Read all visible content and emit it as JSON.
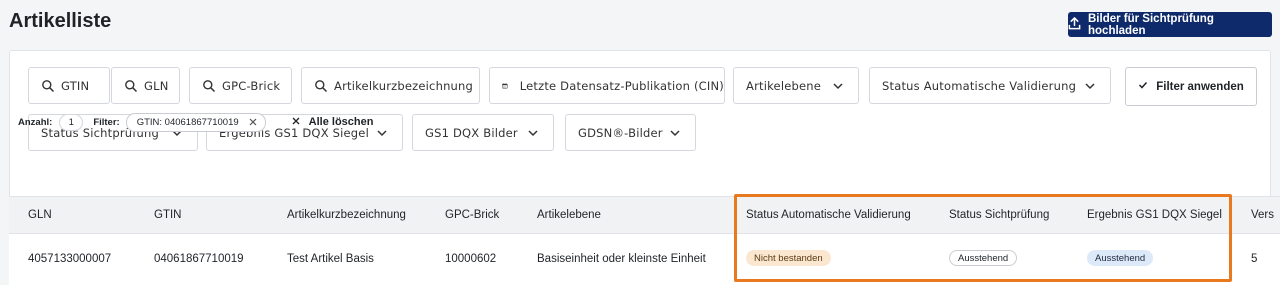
{
  "page": {
    "title": "Artikelliste"
  },
  "upload_button": {
    "label": "Bilder für Sichtprüfung hochladen",
    "icon": "upload-icon"
  },
  "filters": {
    "row1": [
      {
        "label": "GTIN",
        "icon": "search-icon"
      },
      {
        "label": "GLN",
        "icon": "search-icon"
      },
      {
        "label": "GPC-Brick",
        "icon": "search-icon"
      },
      {
        "label": "Artikelkurzbezeichnung",
        "icon": "search-icon"
      },
      {
        "label": "Letzte Datensatz-Publikation (CIN)",
        "icon": "calendar-icon"
      },
      {
        "label": "Artikelebene",
        "icon": "chevron-down-icon"
      },
      {
        "label": "Status Automatische Validierung",
        "icon": "chevron-down-icon"
      }
    ],
    "row2": [
      {
        "label": "Status Sichtprüfung",
        "icon": "chevron-down-icon"
      },
      {
        "label": "Ergebnis GS1 DQX Siegel",
        "icon": "chevron-down-icon"
      },
      {
        "label": "GS1 DQX Bilder",
        "icon": "chevron-down-icon"
      },
      {
        "label": "GDSN®-Bilder",
        "icon": "chevron-down-icon"
      }
    ],
    "apply_label": "Filter anwenden"
  },
  "summary": {
    "count_label": "Anzahl:",
    "count_value": "1",
    "filter_label": "Filter:",
    "active_filter": "GTIN: 04061867710019",
    "clear_all": "Alle löschen"
  },
  "table": {
    "columns": [
      "GLN",
      "GTIN",
      "Artikelkurzbezeichnung",
      "GPC-Brick",
      "Artikelebene",
      "Status Automatische Validierung",
      "Status Sichtprüfung",
      "Ergebnis GS1 DQX Siegel",
      "Vers"
    ],
    "rows": [
      {
        "gln": "4057133000007",
        "gtin": "04061867710019",
        "name": "Test Artikel Basis",
        "gpc": "10000602",
        "level": "Basiseinheit oder kleinste Einheit",
        "auto_validation": "Nicht bestanden",
        "visual_check": "Ausstehend",
        "dqx_result": "Ausstehend",
        "version": "5"
      }
    ]
  },
  "colors": {
    "primary_button": "#0f2a6b",
    "highlight_border": "#e8791e",
    "badge_fail_bg": "#fbe7cf",
    "badge_blue_bg": "#dce9f8"
  }
}
